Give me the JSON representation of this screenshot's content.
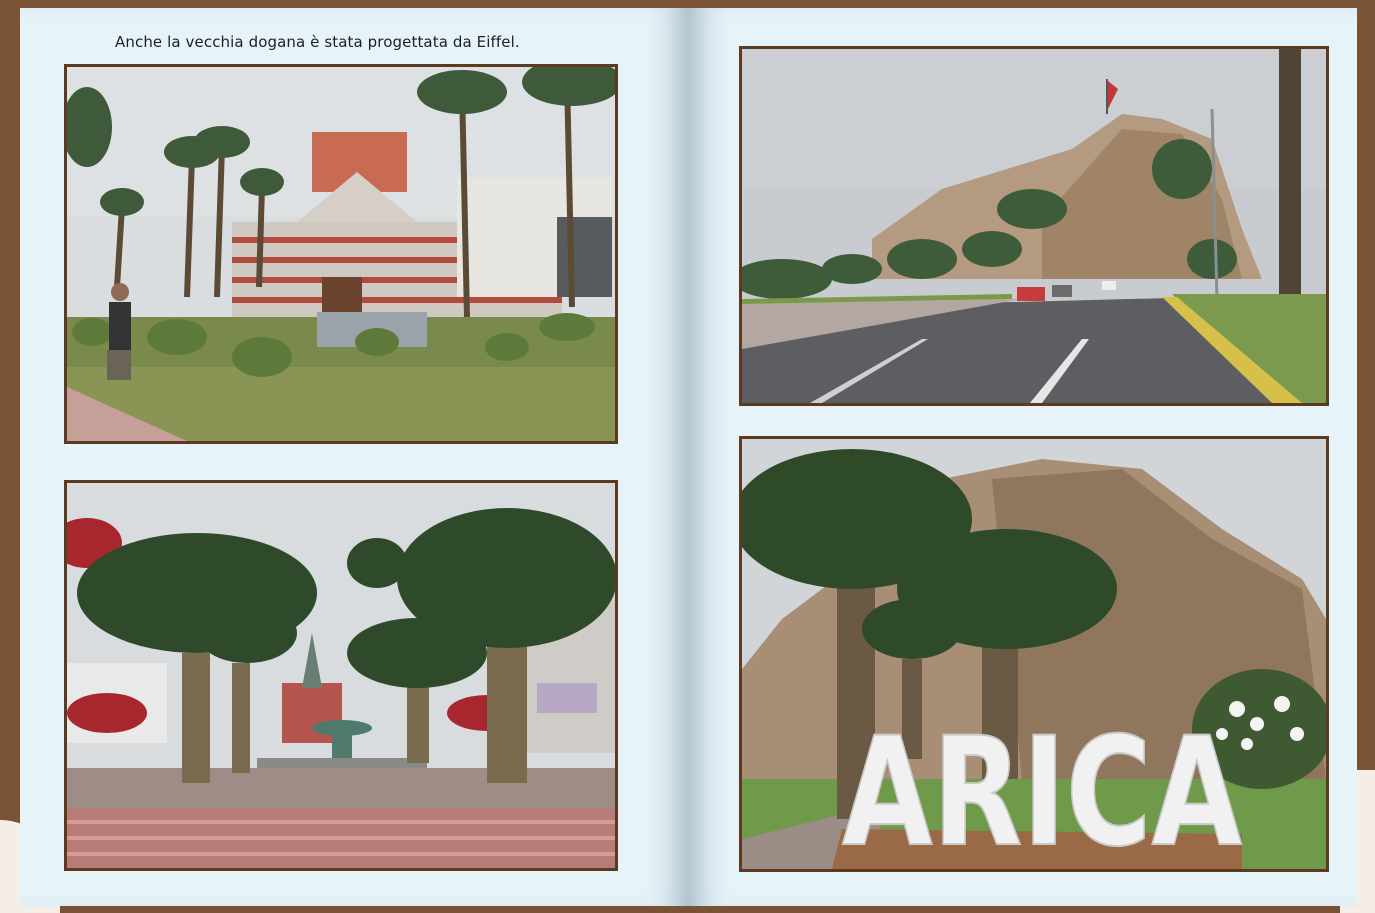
{
  "album": {
    "caption": "Anche la vecchia dogana è stata progettata da Eiffel.",
    "sign_text": "ARICA"
  },
  "photos": [
    {
      "subject": "old customs house with red and white striped facade, palm trees"
    },
    {
      "subject": "plaza with palm trees, fountain and church"
    },
    {
      "subject": "road leading to Morro de Arica with flag on top"
    },
    {
      "subject": "large white ARICA letters in front of the hill with palm trees"
    }
  ],
  "colors": {
    "desk": "#7a5236",
    "page": "#e6f3f9",
    "frame": "#5a3b22"
  }
}
